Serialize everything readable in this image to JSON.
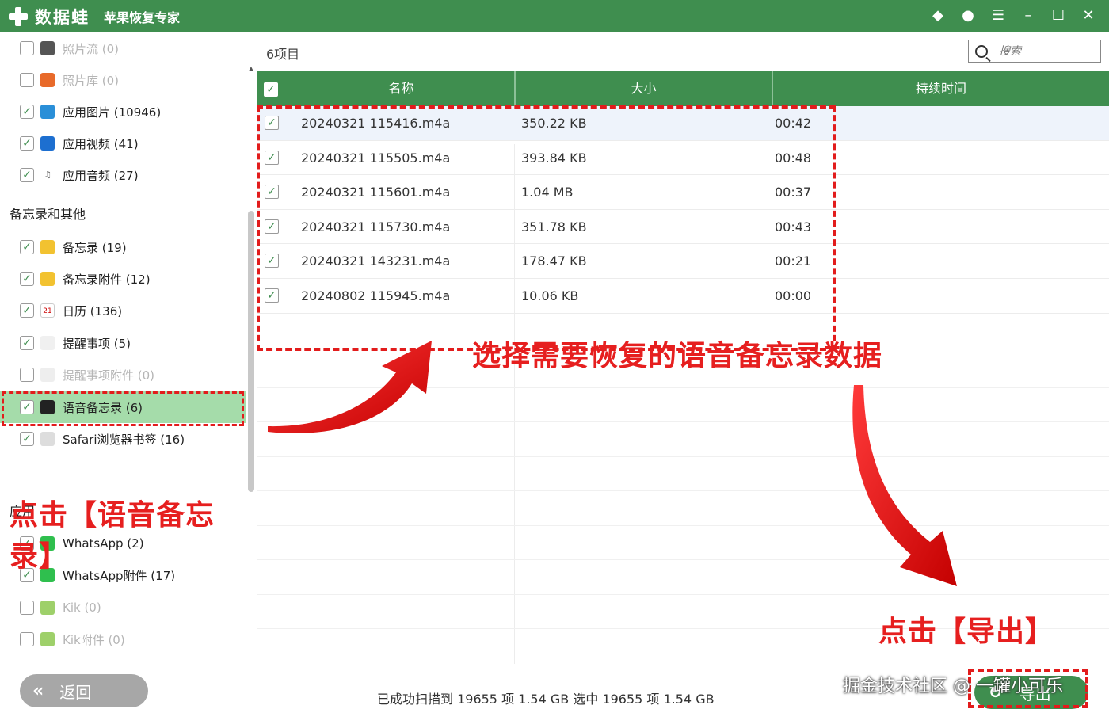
{
  "titlebar": {
    "brand": "数据蛙",
    "product": "苹果恢复专家",
    "icons": [
      "diamond-icon",
      "chat-icon",
      "menu-list-icon",
      "minimize-icon",
      "maximize-icon",
      "close-icon"
    ]
  },
  "sidebar": {
    "items_top": [
      {
        "label": "照片流 (0)",
        "checked": false,
        "dim": true,
        "icon": "camera-icon"
      },
      {
        "label": "照片库 (0)",
        "checked": false,
        "dim": true,
        "icon": "photos-icon"
      },
      {
        "label": "应用图片 (10946)",
        "checked": true,
        "dim": false,
        "icon": "image-icon"
      },
      {
        "label": "应用视频 (41)",
        "checked": true,
        "dim": false,
        "icon": "video-icon"
      },
      {
        "label": "应用音频 (27)",
        "checked": true,
        "dim": false,
        "icon": "music-note-icon"
      }
    ],
    "section_memo": "备忘录和其他",
    "items_memo": [
      {
        "label": "备忘录 (19)",
        "checked": true,
        "dim": false,
        "icon": "notes-icon"
      },
      {
        "label": "备忘录附件 (12)",
        "checked": true,
        "dim": false,
        "icon": "notes-attachment-icon"
      },
      {
        "label": "日历 (136)",
        "checked": true,
        "dim": false,
        "icon": "calendar-icon"
      },
      {
        "label": "提醒事项 (5)",
        "checked": true,
        "dim": false,
        "icon": "reminders-icon"
      },
      {
        "label": "提醒事项附件 (0)",
        "checked": false,
        "dim": true,
        "icon": "reminders-attachment-icon"
      },
      {
        "label": "语音备忘录 (6)",
        "checked": true,
        "dim": false,
        "icon": "voice-memo-icon",
        "active": true
      },
      {
        "label": "Safari浏览器书签 (16)",
        "checked": true,
        "dim": false,
        "icon": "bookmark-icon"
      }
    ],
    "section_apps": "应用",
    "items_apps": [
      {
        "label": "WhatsApp (2)",
        "checked": true,
        "dim": false,
        "icon": "whatsapp-icon"
      },
      {
        "label": "WhatsApp附件 (17)",
        "checked": true,
        "dim": false,
        "icon": "whatsapp-attachment-icon"
      },
      {
        "label": "Kik (0)",
        "checked": false,
        "dim": true,
        "icon": "kik-icon"
      },
      {
        "label": "Kik附件 (0)",
        "checked": false,
        "dim": true,
        "icon": "kik-attachment-icon"
      }
    ]
  },
  "main": {
    "count": "6项目",
    "search_placeholder": "搜索",
    "columns": [
      "名称",
      "大小",
      "持续时间"
    ],
    "rows": [
      {
        "name": "20240321 115416.m4a",
        "size": "350.22 KB",
        "duration": "00:42"
      },
      {
        "name": "20240321 115505.m4a",
        "size": "393.84 KB",
        "duration": "00:48"
      },
      {
        "name": "20240321 115601.m4a",
        "size": "1.04 MB",
        "duration": "00:37"
      },
      {
        "name": "20240321 115730.m4a",
        "size": "351.78 KB",
        "duration": "00:43"
      },
      {
        "name": "20240321 143231.m4a",
        "size": "178.47 KB",
        "duration": "00:21"
      },
      {
        "name": "20240802 115945.m4a",
        "size": "10.06 KB",
        "duration": "00:00"
      }
    ]
  },
  "annotations": {
    "left": "点击【语音备忘录】",
    "main": "选择需要恢复的语音备忘录数据",
    "export": "点击【导出】"
  },
  "bottom": {
    "back_label": "返回",
    "status": "已成功扫描到 19655 项 1.54 GB   选中 19655 项 1.54 GB",
    "watermark": "掘金技术社区 @ 一罐小可乐",
    "export_label": "导出"
  },
  "colors": {
    "brand_green": "#3f8e4f",
    "annotation_red": "#e21c1c",
    "active_row": "#a5dcaa"
  }
}
